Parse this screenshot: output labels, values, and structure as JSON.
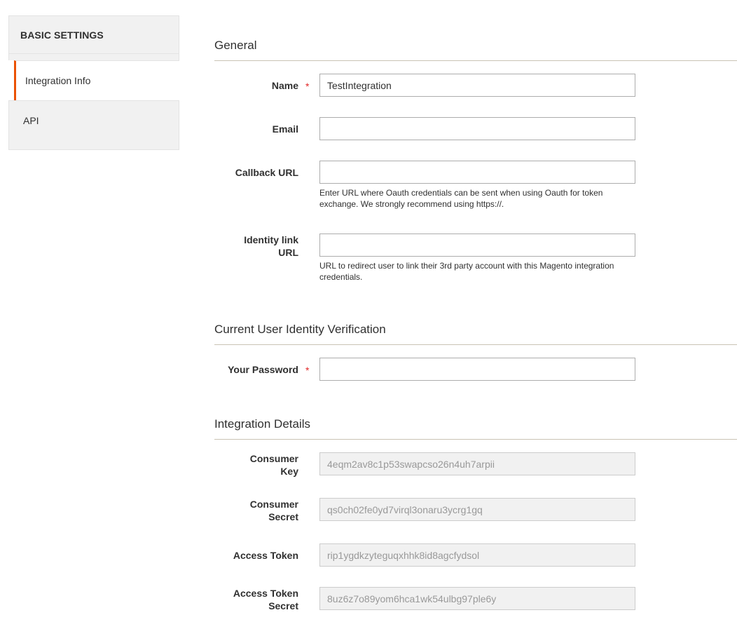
{
  "sidebar": {
    "header": "BASIC SETTINGS",
    "items": [
      {
        "label": "Integration Info",
        "active": true
      },
      {
        "label": "API",
        "active": false
      }
    ]
  },
  "accent_color": "#eb5202",
  "required_color": "#e22626",
  "sections": {
    "general": {
      "title": "General",
      "fields": {
        "name": {
          "label": "Name",
          "required": true,
          "value": "TestIntegration"
        },
        "email": {
          "label": "Email",
          "required": false,
          "value": ""
        },
        "callback_url": {
          "label": "Callback URL",
          "required": false,
          "value": "",
          "note": "Enter URL where Oauth credentials can be sent when using Oauth for token exchange. We strongly recommend using https://."
        },
        "identity_link_url": {
          "label_line1": "Identity link",
          "label_line2": "URL",
          "required": false,
          "value": "",
          "note": "URL to redirect user to link their 3rd party account with this Magento integration credentials."
        }
      }
    },
    "verification": {
      "title": "Current User Identity Verification",
      "fields": {
        "password": {
          "label": "Your Password",
          "required": true,
          "value": ""
        }
      }
    },
    "details": {
      "title": "Integration Details",
      "fields": {
        "consumer_key": {
          "label_line1": "Consumer",
          "label_line2": "Key",
          "value": "4eqm2av8c1p53swapcso26n4uh7arpii"
        },
        "consumer_secret": {
          "label_line1": "Consumer",
          "label_line2": "Secret",
          "value": "qs0ch02fe0yd7virql3onaru3ycrg1gq"
        },
        "access_token": {
          "label": "Access Token",
          "value": "rip1ygdkzyteguqxhhk8id8agcfydsol"
        },
        "access_token_secret": {
          "label_line1": "Access Token",
          "label_line2": "Secret",
          "value": "8uz6z7o89yom6hca1wk54ulbg97ple6y"
        }
      }
    }
  },
  "required_marker": "*"
}
